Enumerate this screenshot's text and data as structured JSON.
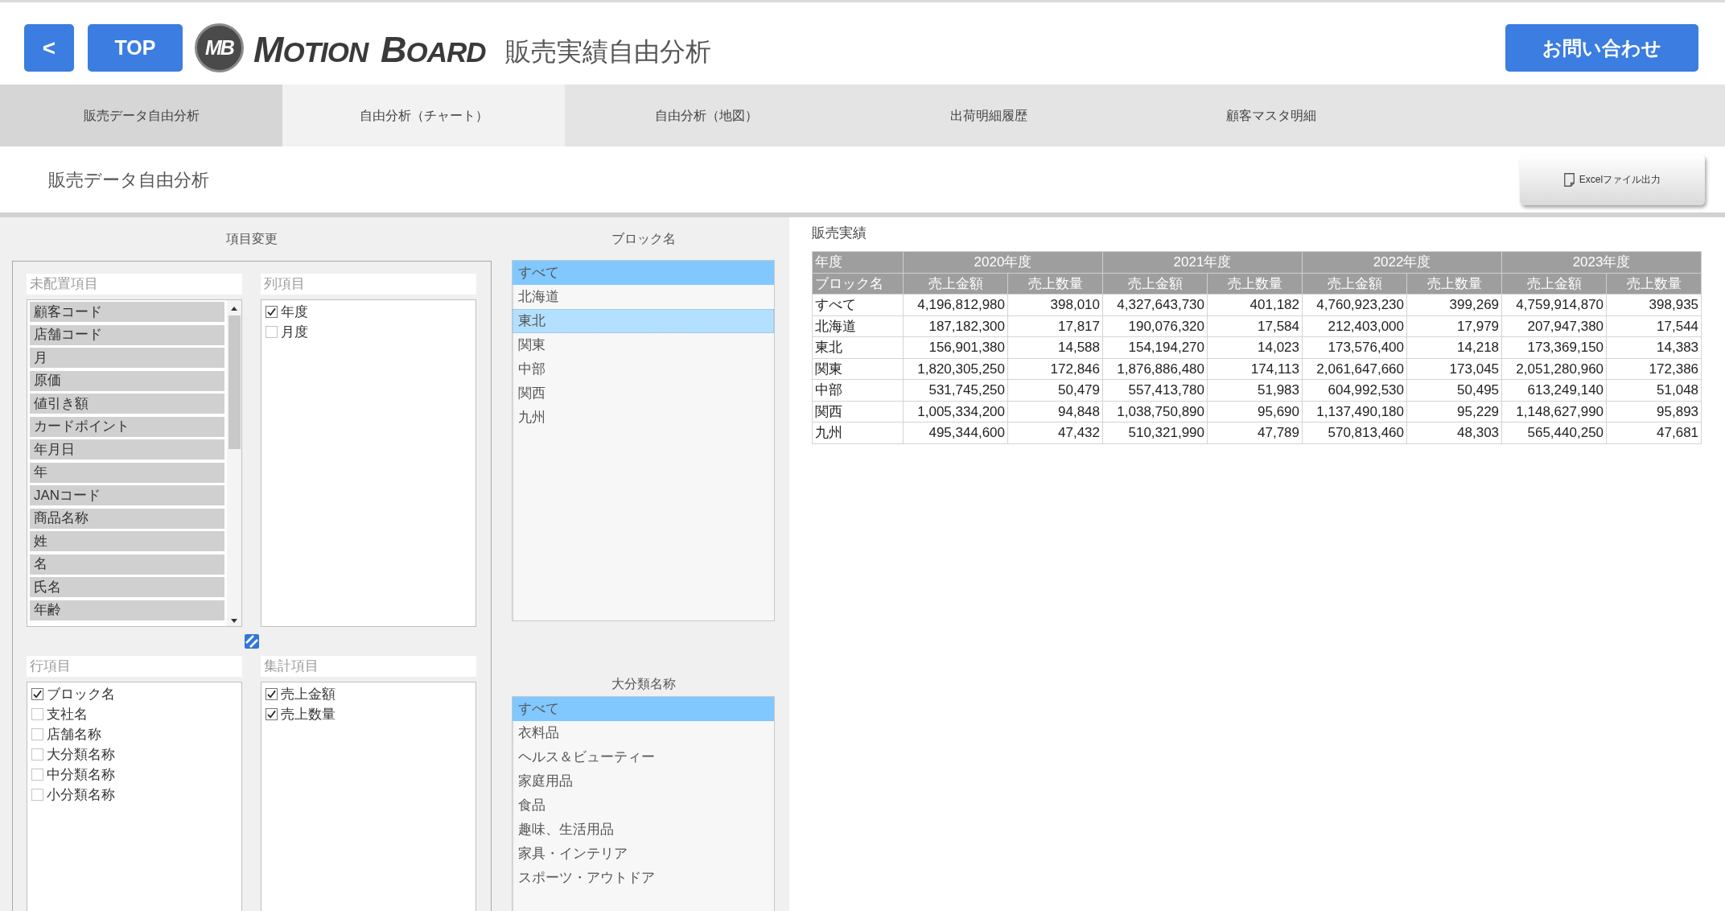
{
  "header": {
    "back_button": "<",
    "top_button": "TOP",
    "logo": {
      "mark": "MB",
      "wordmark": "MOTION BOARD"
    },
    "title": "販売実績自由分析",
    "contact_button": "お問い合わせ"
  },
  "tabs": [
    {
      "label": "販売データ自由分析",
      "selected": true,
      "hovered": false
    },
    {
      "label": "自由分析（チャート）",
      "selected": false,
      "hovered": true
    },
    {
      "label": "自由分析（地図）",
      "selected": false,
      "hovered": false
    },
    {
      "label": "出荷明細履歴",
      "selected": false,
      "hovered": false
    },
    {
      "label": "顧客マスタ明細",
      "selected": false,
      "hovered": false
    }
  ],
  "page": {
    "title": "販売データ自由分析",
    "export_button": "Excelファイル出力"
  },
  "field_settings": {
    "title": "項目変更",
    "unplaced": {
      "label": "未配置項目",
      "items": [
        "顧客コード",
        "店舗コード",
        "月",
        "原価",
        "値引き額",
        "カードポイント",
        "年月日",
        "年",
        "JANコード",
        "商品名称",
        "姓",
        "名",
        "氏名",
        "年齢"
      ]
    },
    "columns": {
      "label": "列項目",
      "items": [
        {
          "label": "年度",
          "checked": true
        },
        {
          "label": "月度",
          "checked": false
        }
      ]
    },
    "rows": {
      "label": "行項目",
      "items": [
        {
          "label": "ブロック名",
          "checked": true
        },
        {
          "label": "支社名",
          "checked": false
        },
        {
          "label": "店舗名称",
          "checked": false
        },
        {
          "label": "大分類名称",
          "checked": false
        },
        {
          "label": "中分類名称",
          "checked": false
        },
        {
          "label": "小分類名称",
          "checked": false
        }
      ]
    },
    "aggregates": {
      "label": "集計項目",
      "items": [
        {
          "label": "売上金額",
          "checked": true
        },
        {
          "label": "売上数量",
          "checked": true
        }
      ]
    }
  },
  "filters": [
    {
      "title": "ブロック名",
      "items": [
        {
          "label": "すべて",
          "selected": true,
          "focused": false
        },
        {
          "label": "北海道",
          "selected": false,
          "focused": false
        },
        {
          "label": "東北",
          "selected": false,
          "focused": true
        },
        {
          "label": "関東",
          "selected": false,
          "focused": false
        },
        {
          "label": "中部",
          "selected": false,
          "focused": false
        },
        {
          "label": "関西",
          "selected": false,
          "focused": false
        },
        {
          "label": "九州",
          "selected": false,
          "focused": false
        }
      ]
    },
    {
      "title": "大分類名称",
      "items": [
        {
          "label": "すべて",
          "selected": true,
          "focused": false
        },
        {
          "label": "衣料品",
          "selected": false,
          "focused": false
        },
        {
          "label": "ヘルス＆ビューティー",
          "selected": false,
          "focused": false
        },
        {
          "label": "家庭用品",
          "selected": false,
          "focused": false
        },
        {
          "label": "食品",
          "selected": false,
          "focused": false
        },
        {
          "label": "趣味、生活用品",
          "selected": false,
          "focused": false
        },
        {
          "label": "家具・インテリア",
          "selected": false,
          "focused": false
        },
        {
          "label": "スポーツ・アウトドア",
          "selected": false,
          "focused": false
        }
      ]
    }
  ],
  "table": {
    "title": "販売実績",
    "column_header_label": "年度",
    "row_header_label": "ブロック名",
    "column_groups": [
      {
        "label": "2020年度",
        "columns": [
          "売上金額",
          "売上数量"
        ]
      },
      {
        "label": "2021年度",
        "columns": [
          "売上金額",
          "売上数量"
        ]
      },
      {
        "label": "2022年度",
        "columns": [
          "売上金額",
          "売上数量"
        ]
      },
      {
        "label": "2023年度",
        "columns": [
          "売上金額",
          "売上数量"
        ]
      }
    ],
    "rows": [
      {
        "label": "すべて",
        "cells": [
          "4,196,812,980",
          "398,010",
          "4,327,643,730",
          "401,182",
          "4,760,923,230",
          "399,269",
          "4,759,914,870",
          "398,935"
        ]
      },
      {
        "label": "北海道",
        "cells": [
          "187,182,300",
          "17,817",
          "190,076,320",
          "17,584",
          "212,403,000",
          "17,979",
          "207,947,380",
          "17,544"
        ]
      },
      {
        "label": "東北",
        "cells": [
          "156,901,380",
          "14,588",
          "154,194,270",
          "14,023",
          "173,576,400",
          "14,218",
          "173,369,150",
          "14,383"
        ]
      },
      {
        "label": "関東",
        "cells": [
          "1,820,305,250",
          "172,846",
          "1,876,886,480",
          "174,113",
          "2,061,647,660",
          "173,045",
          "2,051,280,960",
          "172,386"
        ]
      },
      {
        "label": "中部",
        "cells": [
          "531,745,250",
          "50,479",
          "557,413,780",
          "51,983",
          "604,992,530",
          "50,495",
          "613,249,140",
          "51,048"
        ]
      },
      {
        "label": "関西",
        "cells": [
          "1,005,334,200",
          "94,848",
          "1,038,750,890",
          "95,690",
          "1,137,490,180",
          "95,229",
          "1,148,627,990",
          "95,893"
        ]
      },
      {
        "label": "九州",
        "cells": [
          "495,344,600",
          "47,432",
          "510,321,990",
          "47,789",
          "570,813,460",
          "48,303",
          "565,440,250",
          "47,681"
        ]
      }
    ]
  }
}
